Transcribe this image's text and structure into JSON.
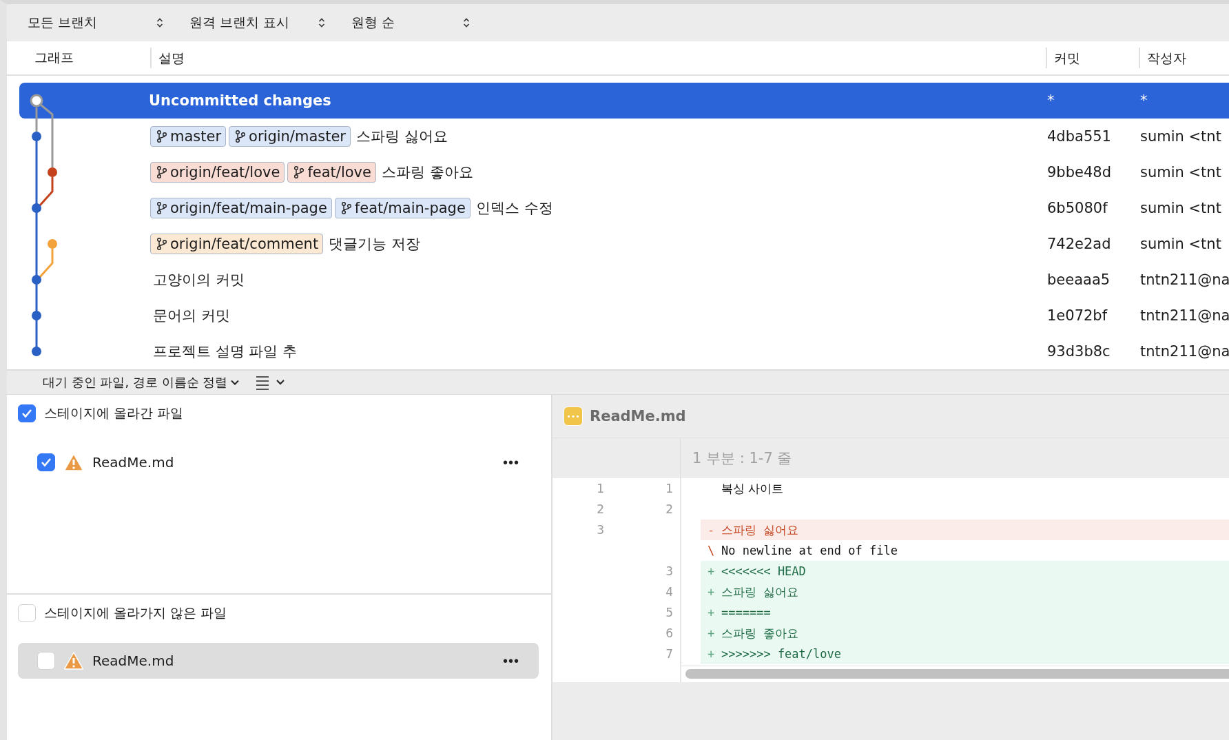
{
  "filters": [
    {
      "label": "모든 브랜치"
    },
    {
      "label": "원격 브랜치 표시"
    },
    {
      "label": "원형 순"
    }
  ],
  "table": {
    "columns": [
      "그래프",
      "설명",
      "커밋",
      "작성자"
    ],
    "rows": [
      {
        "kind": "working",
        "selected": true,
        "color": "#9a9a9a",
        "tags": [],
        "description": "Uncommitted changes",
        "commit": "*",
        "author": "*"
      },
      {
        "kind": "main",
        "selected": false,
        "color": "#2a5fc4",
        "tags": [
          {
            "label": "master",
            "color": "#dbe6f9"
          },
          {
            "label": "origin/master",
            "color": "#dbe6f9"
          }
        ],
        "description": "스파링 싫어요",
        "commit": "4dba551",
        "author": "sumin <tnt"
      },
      {
        "kind": "side",
        "selected": false,
        "color": "#c4421c",
        "tags": [
          {
            "label": "origin/feat/love",
            "color": "#f9dcd4"
          },
          {
            "label": "feat/love",
            "color": "#f9dcd4"
          }
        ],
        "description": "스파링 좋아요",
        "commit": "9bbe48d",
        "author": "sumin <tnt"
      },
      {
        "kind": "main",
        "selected": false,
        "color": "#2a5fc4",
        "tags": [
          {
            "label": "origin/feat/main-page",
            "color": "#dbe6f9"
          },
          {
            "label": "feat/main-page",
            "color": "#dbe6f9"
          }
        ],
        "description": "인덱스 수정",
        "commit": "6b5080f",
        "author": "sumin <tnt"
      },
      {
        "kind": "side",
        "selected": false,
        "color": "#f3a33a",
        "tags": [
          {
            "label": "origin/feat/comment",
            "color": "#fbe9d3"
          }
        ],
        "description": "댓글기능 저장",
        "commit": "742e2ad",
        "author": "sumin <tnt"
      },
      {
        "kind": "main",
        "selected": false,
        "color": "#2a5fc4",
        "tags": [],
        "description": "고양이의 커밋",
        "commit": "beeaaa5",
        "author": "tntn211@na"
      },
      {
        "kind": "main",
        "selected": false,
        "color": "#2a5fc4",
        "tags": [],
        "description": "문어의 커밋",
        "commit": "1e072bf",
        "author": "tntn211@na"
      },
      {
        "kind": "main",
        "selected": false,
        "color": "#2a5fc4",
        "tags": [],
        "description": "프로젝트 설명 파일 추",
        "commit": "93d3b8c",
        "author": "tntn211@na"
      }
    ]
  },
  "sort_bar": {
    "label": "대기 중인 파일, 경로 이름순 정렬"
  },
  "staged": {
    "title": "스테이지에 올라간 파일",
    "checked": true,
    "files": [
      {
        "name": "ReadMe.md",
        "checked": true,
        "selected": false,
        "more": "•••"
      }
    ]
  },
  "unstaged": {
    "title": "스테이지에 올라가지 않은 파일",
    "checked": false,
    "files": [
      {
        "name": "ReadMe.md",
        "checked": false,
        "selected": true,
        "more": "•••"
      }
    ]
  },
  "diff": {
    "file_icon": "•••",
    "file": "ReadMe.md",
    "hunk": "1 부분 : 1-7 줄",
    "lines": [
      {
        "kind": "context",
        "old": "1",
        "new": "1",
        "text": "복싱 사이트"
      },
      {
        "kind": "context",
        "old": "2",
        "new": "2"
      },
      {
        "kind": "removed",
        "old": "3",
        "sign": "-",
        "text": "스파링 싫어요"
      },
      {
        "kind": "note",
        "sign": "\\",
        "text": "No newline at end of file"
      },
      {
        "kind": "added",
        "new": "3",
        "sign": "+",
        "text": "<<<<<<< HEAD"
      },
      {
        "kind": "added",
        "new": "4",
        "sign": "+",
        "text": "스파링 싫어요"
      },
      {
        "kind": "added",
        "new": "5",
        "sign": "+",
        "text": "======="
      },
      {
        "kind": "added",
        "new": "6",
        "sign": "+",
        "text": "스파링 좋아요"
      },
      {
        "kind": "added",
        "new": "7",
        "sign": "+",
        "text": ">>>>>>> feat/love"
      }
    ]
  }
}
